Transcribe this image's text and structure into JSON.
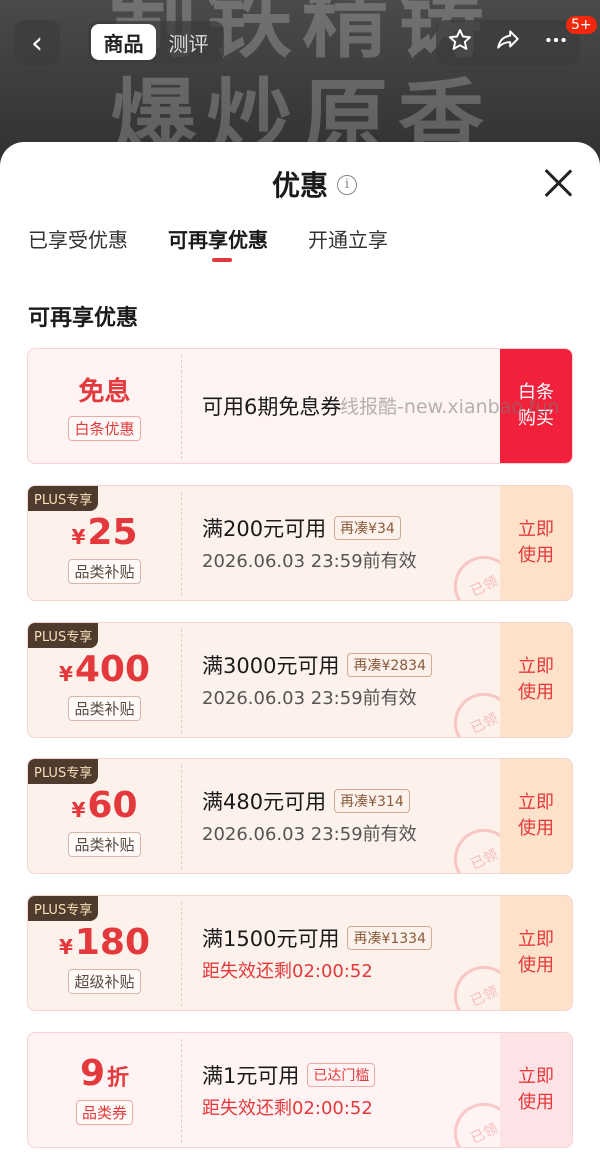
{
  "banner": {
    "bg_text": "制铁精铸\n爆炒原香"
  },
  "topbar": {
    "back_icon": "‹",
    "tabs": [
      {
        "label": "商品"
      },
      {
        "label": "测评"
      }
    ],
    "badge": "5+"
  },
  "sheet": {
    "title": "优惠",
    "info_icon": "i",
    "tabs": [
      {
        "label": "已享受优惠"
      },
      {
        "label": "可再享优惠"
      },
      {
        "label": "开通立享"
      }
    ],
    "section_title": "可再享优惠"
  },
  "coupons": [
    {
      "big": "免息",
      "category": "白条优惠",
      "condition": "可用6期免息券",
      "action": "白条购买"
    },
    {
      "plus": "PLUS专享",
      "currency": "¥",
      "amount": "25",
      "category": "品类补贴",
      "condition": "满200元可用",
      "tag": "再凑¥34",
      "expire": "2026.06.03 23:59前有效",
      "action": "立即使用",
      "stamp": "已领"
    },
    {
      "plus": "PLUS专享",
      "currency": "¥",
      "amount": "400",
      "category": "品类补贴",
      "condition": "满3000元可用",
      "tag": "再凑¥2834",
      "expire": "2026.06.03 23:59前有效",
      "action": "立即使用",
      "stamp": "已领"
    },
    {
      "plus": "PLUS专享",
      "currency": "¥",
      "amount": "60",
      "category": "品类补贴",
      "condition": "满480元可用",
      "tag": "再凑¥314",
      "expire": "2026.06.03 23:59前有效",
      "action": "立即使用",
      "stamp": "已领"
    },
    {
      "plus": "PLUS专享",
      "currency": "¥",
      "amount": "180",
      "category": "超级补贴",
      "condition": "满1500元可用",
      "tag": "再凑¥1334",
      "expire": "距失效还剩02:00:52",
      "action": "立即使用",
      "stamp": "已领"
    },
    {
      "amount": "9",
      "unit": "折",
      "category": "品类券",
      "condition": "满1元可用",
      "tag": "已达门槛",
      "expire": "距失效还剩02:00:52",
      "action": "立即使用",
      "stamp": "已领"
    }
  ],
  "watermark": "线报酷-new.xianbao.fun",
  "colors": {
    "accent": "#e4393c",
    "plus_bg": "#4e3b2e",
    "action_bg": "#fde1c9"
  }
}
